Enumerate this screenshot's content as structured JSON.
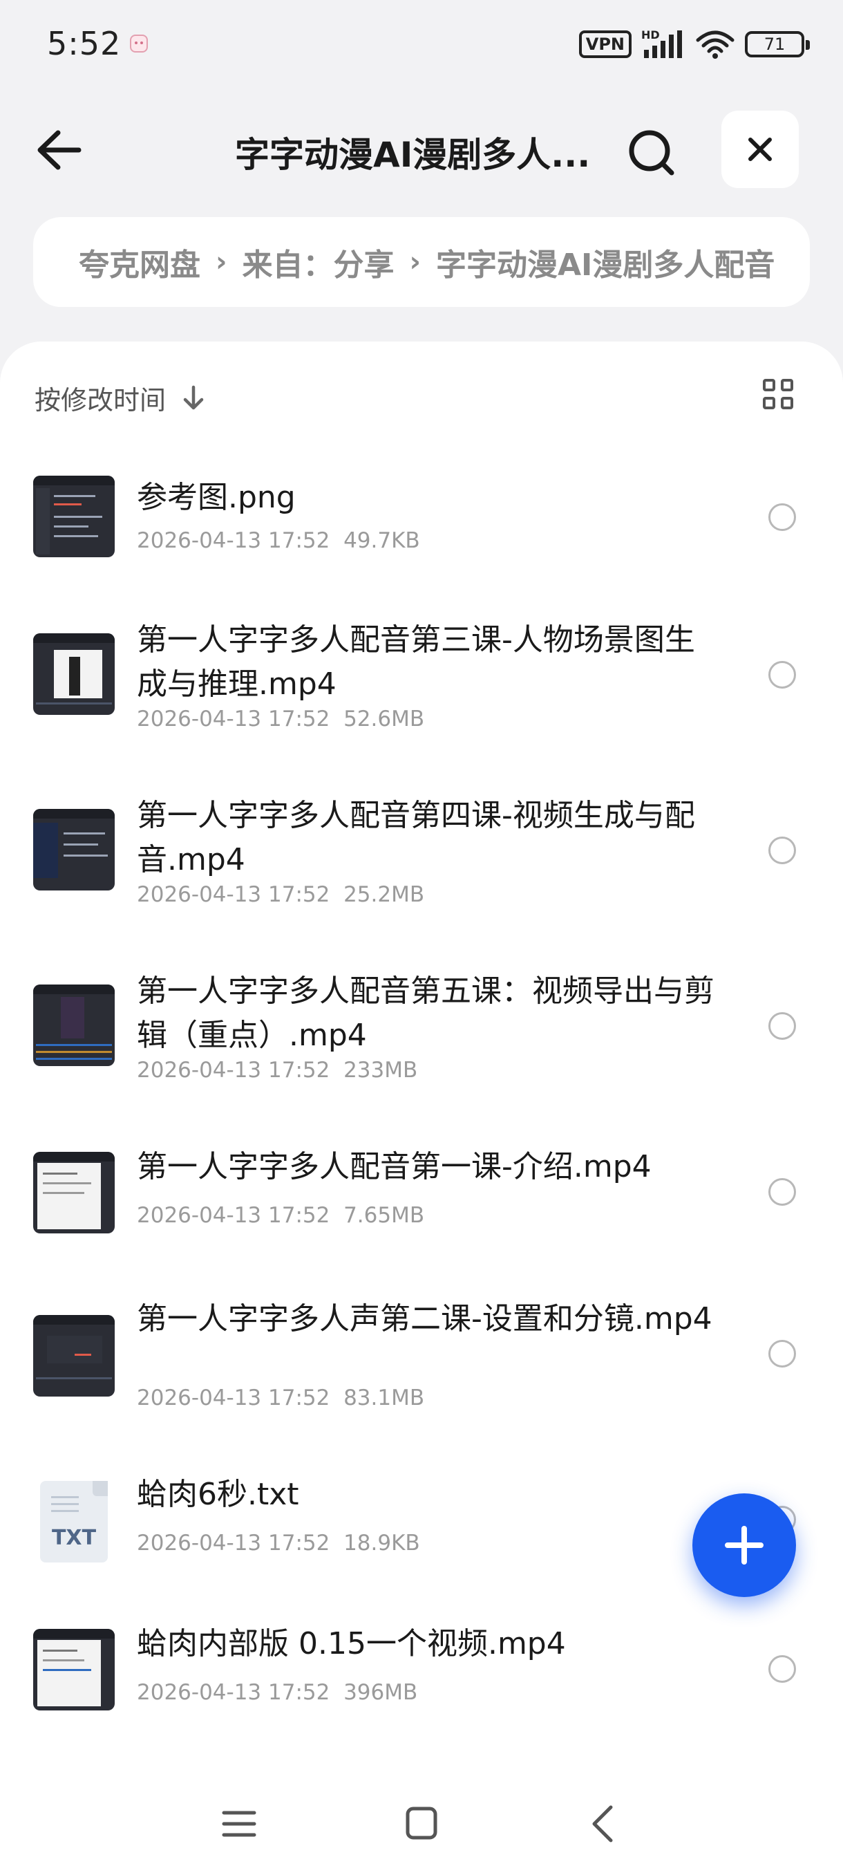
{
  "status_bar": {
    "time": "5:52",
    "vpn_label": "VPN",
    "network_label": "HD",
    "battery_level": "71",
    "icons": [
      "app-notification-icon",
      "signal-icon",
      "wifi-icon",
      "battery-icon"
    ]
  },
  "header": {
    "title": "字字动漫AI漫剧多人...",
    "back_icon": "arrow-left-icon",
    "search_icon": "search-icon",
    "close_icon": "close-icon"
  },
  "breadcrumb": {
    "items": [
      "夸克网盘",
      "来自：分享",
      "字字动漫AI漫剧多人配音"
    ]
  },
  "sort": {
    "label": "按修改时间",
    "direction_icon": "arrow-down-icon",
    "view_toggle_icon": "grid-view-icon"
  },
  "files": [
    {
      "name": "参考图.png",
      "date": "2026-04-13 17:52",
      "size": "49.7KB",
      "type": "image"
    },
    {
      "name": "第一人字字多人配音第三课-人物场景图生成与推理.mp4",
      "date": "2026-04-13 17:52",
      "size": "52.6MB",
      "type": "video"
    },
    {
      "name": "第一人字字多人配音第四课-视频生成与配音.mp4",
      "date": "2026-04-13 17:52",
      "size": "25.2MB",
      "type": "video"
    },
    {
      "name": "第一人字字多人配音第五课：视频导出与剪辑（重点）.mp4",
      "date": "2026-04-13 17:52",
      "size": "233MB",
      "type": "video"
    },
    {
      "name": "第一人字字多人配音第一课-介绍.mp4",
      "date": "2026-04-13 17:52",
      "size": "7.65MB",
      "type": "video"
    },
    {
      "name": "第一人字字多人声第二课-设置和分镜.mp4",
      "date": "2026-04-13 17:52",
      "size": "83.1MB",
      "type": "video"
    },
    {
      "name": "蛤肉6秒.txt",
      "date": "2026-04-13 17:52",
      "size": "18.9KB",
      "type": "txt",
      "thumb_label": "TXT"
    },
    {
      "name": "蛤肉内部版 0.15一个视频.mp4",
      "date": "2026-04-13 17:52",
      "size": "396MB",
      "type": "video"
    }
  ],
  "fab": {
    "icon": "plus-icon"
  },
  "nav_bar": {
    "icons": [
      "menu-icon",
      "home-square-icon",
      "back-chevron-icon"
    ]
  },
  "colors": {
    "accent": "#1a5cf0",
    "background": "#f2f2f4",
    "meta_text": "#9a9a9a"
  }
}
